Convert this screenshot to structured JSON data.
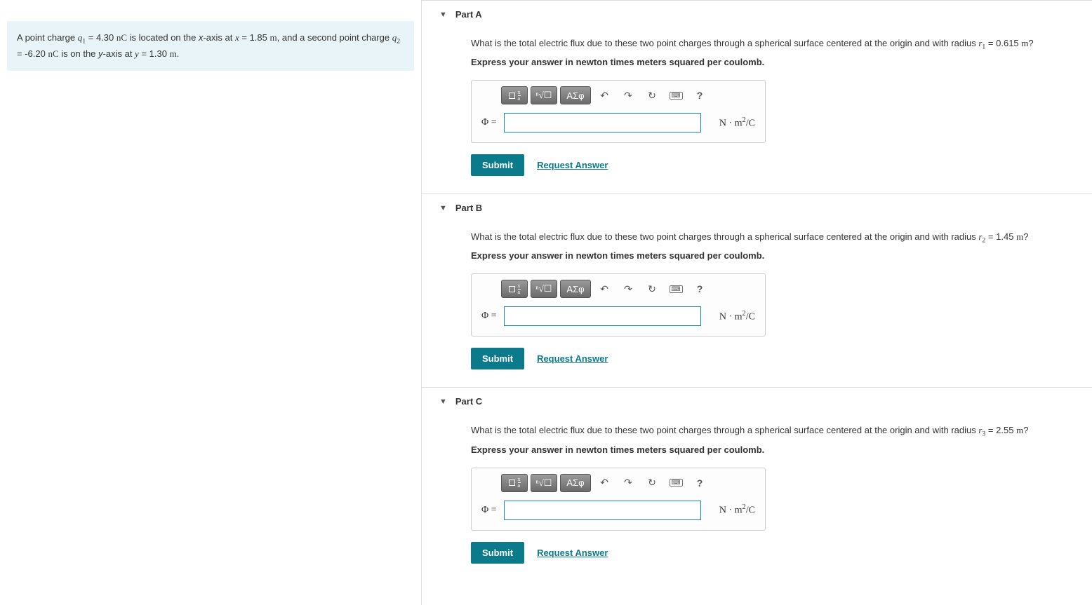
{
  "problem": {
    "q1_label": "q₁",
    "q1_value": "4.30",
    "q1_unit": "nC",
    "q1_axis": "x-axis",
    "q1_pos_var": "x",
    "q1_pos": "1.85",
    "q1_pos_unit": "m",
    "q2_label": "q₂",
    "q2_value": "-6.20",
    "q2_unit": "nC",
    "q2_axis": "y-axis",
    "q2_pos_var": "y",
    "q2_pos": "1.30",
    "q2_pos_unit": "m"
  },
  "common": {
    "question_prefix": "What is the total electric flux due to these two point charges through a spherical surface centered at the origin and with radius ",
    "instruction": "Express your answer in newton times meters squared per coulomb.",
    "phi_label": "Φ =",
    "unit_label": "N · m² / C",
    "submit": "Submit",
    "request": "Request Answer",
    "greek": "ΑΣφ",
    "help": "?"
  },
  "parts": {
    "a": {
      "title": "Part A",
      "r_label": "r₁",
      "r_value": "0.615",
      "r_unit": "m"
    },
    "b": {
      "title": "Part B",
      "r_label": "r₂",
      "r_value": "1.45",
      "r_unit": "m"
    },
    "c": {
      "title": "Part C",
      "r_label": "r₃",
      "r_value": "2.55",
      "r_unit": "m"
    }
  }
}
